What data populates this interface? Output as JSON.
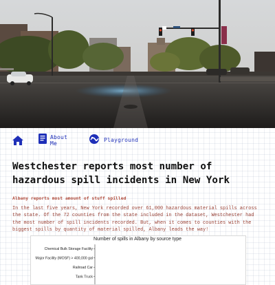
{
  "nav": {
    "items": [
      {
        "label": "",
        "icon": "home-icon"
      },
      {
        "label": "About Me",
        "icon": "document-icon"
      },
      {
        "label": "Playground",
        "icon": "playground-icon"
      }
    ],
    "accent": "#1e2fb8"
  },
  "article": {
    "title": "Westchester reports most number of hazardous spill incidents in New York",
    "subtitle": "Albany reports most amount of stuff spilled",
    "body": "In the last five years, New York recorded over 61,000 hazardous material spills across the state. Of the 72 counties from the state included in the dataset, Westchester had the most number of spill incidents recorded. But, when it comes to counties with the biggest spills by quantity of material spilled, Albany leads the way!"
  },
  "chart_data": {
    "type": "bar",
    "title": "Number of spills in Albany by source type",
    "categories": [
      "Chemical Bulk Storage Facility",
      "Major Facility (MOSF) > 400,000 gal",
      "Railroad Car",
      "Tank Truck"
    ],
    "values": [
      null,
      null,
      null,
      null
    ],
    "orientation": "horizontal"
  },
  "colors": {
    "title": "#111111",
    "subtitle": "#b04a3a",
    "body": "#9a4236"
  }
}
